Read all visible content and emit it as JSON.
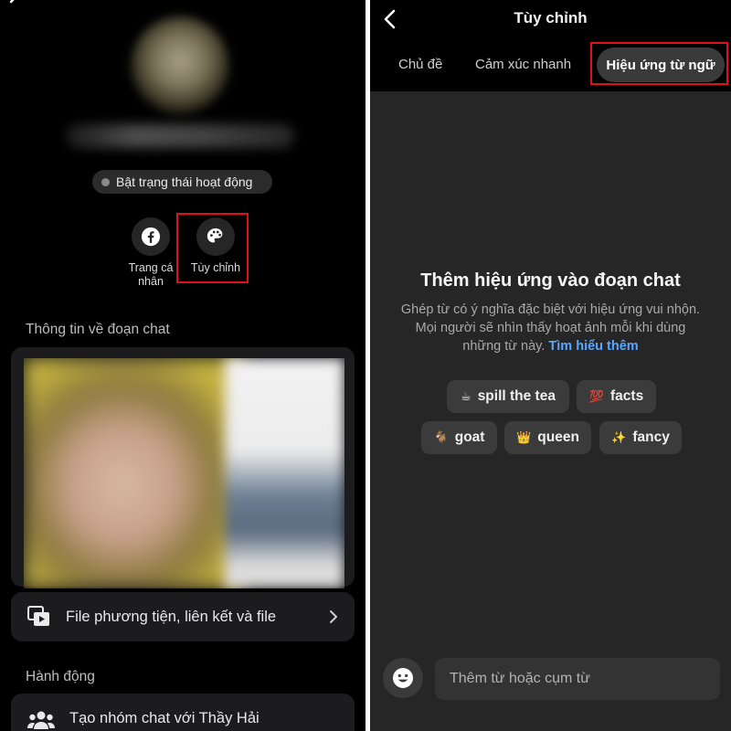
{
  "left": {
    "status_pill": "Bật trạng thái hoạt động",
    "actions": [
      {
        "label": "Trang cá nhân",
        "icon": "facebook-icon"
      },
      {
        "label": "Tùy chỉnh",
        "icon": "palette-icon"
      }
    ],
    "chat_info_title": "Thông tin về đoạn chat",
    "media_row": "File phương tiện, liên kết và file",
    "actions_title": "Hành động",
    "create_group_row": "Tạo nhóm chat với Thầy Hải"
  },
  "right": {
    "title": "Tùy chỉnh",
    "tabs": [
      "Chủ đề",
      "Cảm xúc nhanh",
      "Hiệu ứng từ ngữ"
    ],
    "active_tab": "Hiệu ứng từ ngữ",
    "headline": "Thêm hiệu ứng vào đoạn chat",
    "description": "Ghép từ có ý nghĩa đặc biệt với hiệu ứng vui nhộn. Mọi người sẽ nhìn thấy hoạt ảnh mỗi khi dùng những từ này.",
    "learn_more": "Tìm hiểu thêm",
    "chips": [
      {
        "emoji": "☕",
        "label": "spill the tea"
      },
      {
        "emoji": "💯",
        "label": "facts"
      },
      {
        "emoji": "🐐",
        "label": "goat"
      },
      {
        "emoji": "👑",
        "label": "queen"
      },
      {
        "emoji": "✨",
        "label": "fancy"
      }
    ],
    "input_placeholder": "Thêm từ hoặc cụm từ"
  },
  "colors": {
    "highlight": "#e0101a",
    "link": "#5aa7ff",
    "left_bg": "#000000",
    "right_bg": "#262626"
  }
}
